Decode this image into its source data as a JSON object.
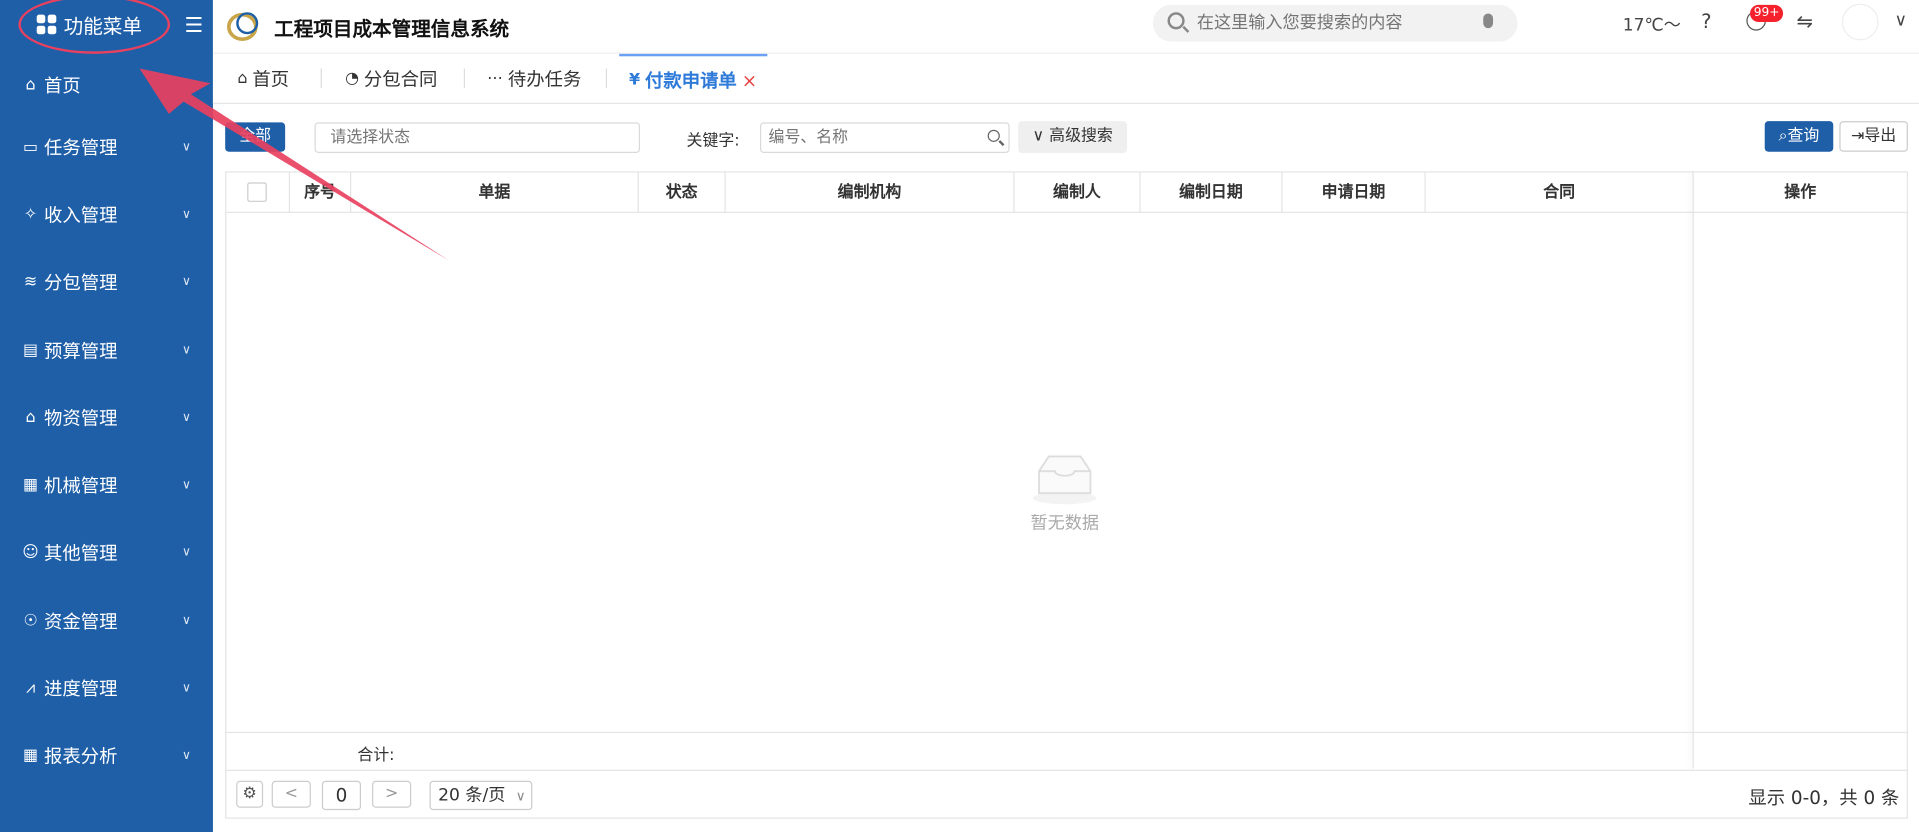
{
  "sidebar": {
    "header": "功能菜单",
    "collapse_icon": "☰",
    "items": [
      {
        "label": "首页",
        "icon": "home-icon"
      },
      {
        "label": "任务管理",
        "icon": "folder-icon"
      },
      {
        "label": "收入管理",
        "icon": "pin-icon"
      },
      {
        "label": "分包管理",
        "icon": "database-icon"
      },
      {
        "label": "预算管理",
        "icon": "list-icon"
      },
      {
        "label": "物资管理",
        "icon": "bank-icon"
      },
      {
        "label": "机械管理",
        "icon": "grid-icon"
      },
      {
        "label": "其他管理",
        "icon": "people-icon"
      },
      {
        "label": "资金管理",
        "icon": "money-icon"
      },
      {
        "label": "进度管理",
        "icon": "chart-icon"
      },
      {
        "label": "报表分析",
        "icon": "table-icon"
      }
    ]
  },
  "header": {
    "app_title": "工程项目成本管理信息系统",
    "search_placeholder": "在这里输入您要搜索的内容",
    "weather": "17℃～",
    "help": "?",
    "badge": "99+",
    "swap": "⇋",
    "user_dropdown": "∨"
  },
  "tabs": [
    {
      "label": "首页",
      "icon": "⌂"
    },
    {
      "label": "分包合同",
      "icon": "◔"
    },
    {
      "label": "待办任务",
      "icon": "⋯"
    },
    {
      "label": "付款申请单",
      "icon": "¥",
      "close": "×"
    }
  ],
  "toolbar": {
    "all_label": "全部",
    "status_placeholder": "请选择状态",
    "keyword_label": "关键字:",
    "keyword_placeholder": "编号、名称",
    "advanced_label": "∨ 高级搜索",
    "query_label": "查询",
    "export_label": "导出"
  },
  "table": {
    "columns": [
      "序号",
      "单据",
      "状态",
      "编制机构",
      "编制人",
      "编制日期",
      "申请日期",
      "合同",
      "操作"
    ],
    "empty_text": "暂无数据",
    "sum_label": "合计:"
  },
  "pager": {
    "settings_icon": "⚙",
    "prev": "<",
    "page": "0",
    "next": ">",
    "page_size": "20 条/页",
    "info": "显示 0-0，共 0 条"
  },
  "colors": {
    "sidebar_bg": "#1f5fa8",
    "primary": "#1f5fa8",
    "active_tab": "#2e7ad9",
    "annotation": "#e8415f"
  }
}
